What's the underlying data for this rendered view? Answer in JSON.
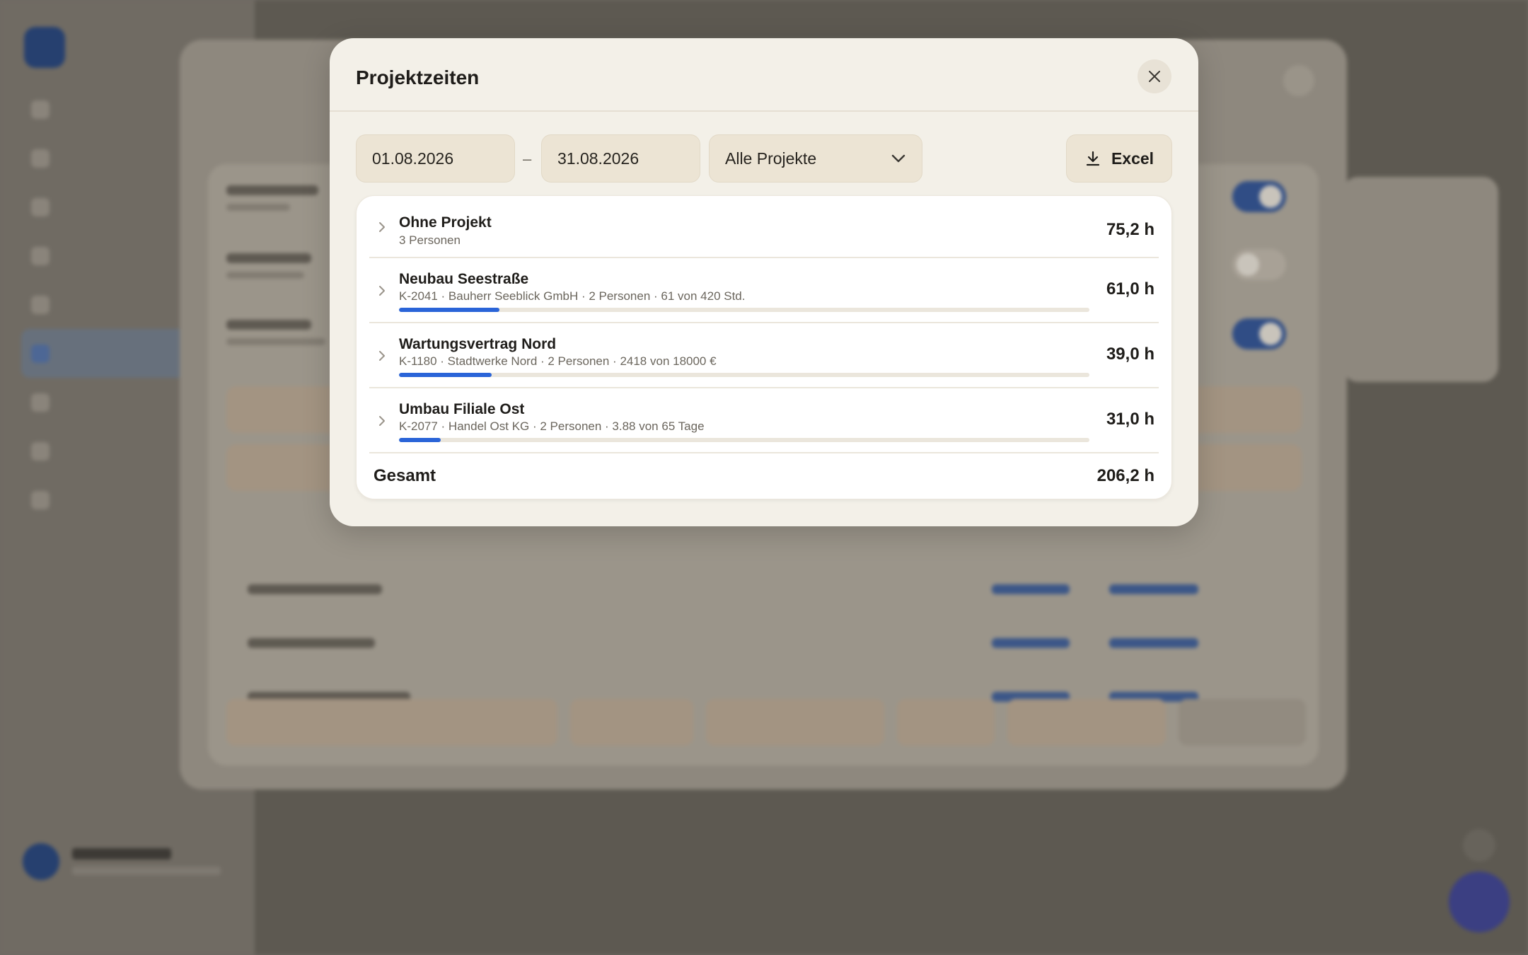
{
  "modal": {
    "title": "Projektzeiten",
    "filters": {
      "date_from": "01.08.2026",
      "date_separator": "–",
      "date_to": "31.08.2026",
      "project_select": "Alle Projekte",
      "export_label": "Excel"
    },
    "rows": [
      {
        "name": "Ohne Projekt",
        "sub": "3 Personen",
        "hours": "75,2 h"
      },
      {
        "name": "Neubau Seestraße",
        "sub": "K-2041 · Bauherr Seeblick GmbH · 2 Personen · 61 von 420 Std.",
        "hours": "61,0 h",
        "progress": 0.145
      },
      {
        "name": "Wartungsvertrag Nord",
        "sub": "K-1180 · Stadtwerke Nord · 2 Personen · 2418 von 18000 €",
        "hours": "39,0 h",
        "progress": 0.134
      },
      {
        "name": "Umbau Filiale Ost",
        "sub": "K-2077 · Handel Ost KG · 2 Personen · 3.88 von 65 Tage",
        "hours": "31,0 h",
        "progress": 0.06
      }
    ],
    "total": {
      "label": "Gesamt",
      "value": "206,2 h"
    }
  },
  "colors": {
    "accent": "#2a64d8",
    "modal_bg": "#f3f0e8",
    "field_bg": "#ece4d4"
  },
  "icons": {
    "close": "close-icon",
    "download": "download-icon",
    "chevron_down": "chevron-down-icon",
    "chevron_right": "chevron-right-icon"
  }
}
